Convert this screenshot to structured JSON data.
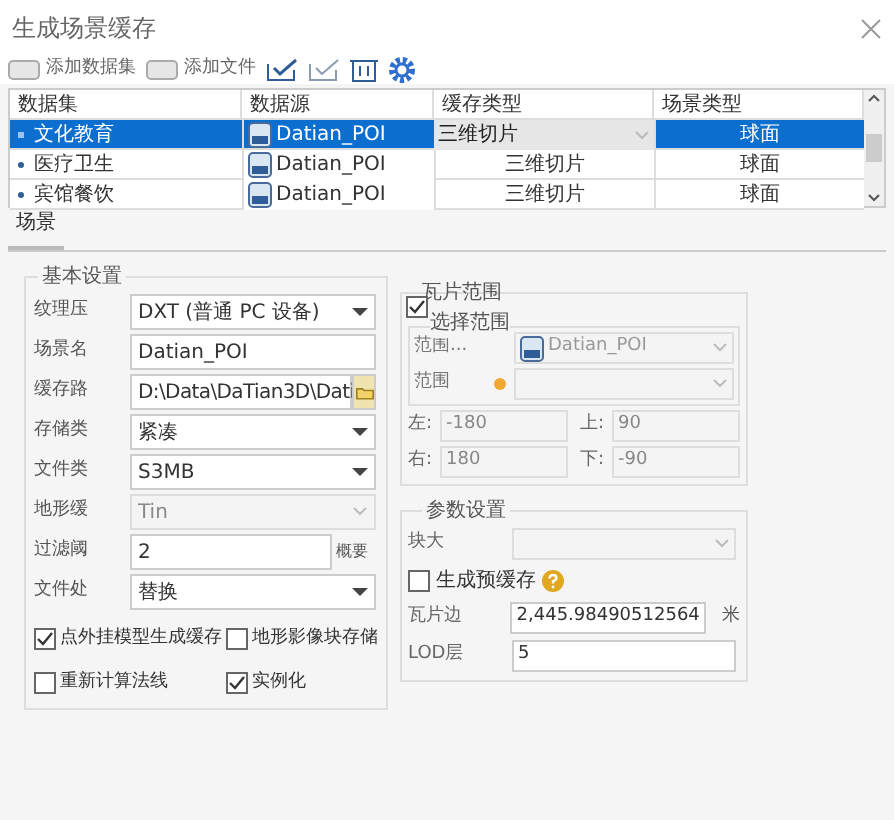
{
  "window": {
    "title": "生成场景缓存"
  },
  "toolbar": [
    {
      "kind": "text",
      "label": "添加数据集"
    },
    {
      "kind": "text",
      "label": "添加文件"
    },
    {
      "kind": "check-all"
    },
    {
      "kind": "check-none"
    },
    {
      "kind": "delete"
    },
    {
      "kind": "settings"
    }
  ],
  "table": {
    "columns": [
      "数据集",
      "数据源",
      "缓存类型",
      "场景类型"
    ],
    "rows": [
      {
        "dataset": "文化教育",
        "source": "Datian_POI",
        "cache_type": "三维切片",
        "scene_type": "球面",
        "selected": true
      },
      {
        "dataset": "医疗卫生",
        "source": "Datian_POI",
        "cache_type": "三维切片",
        "scene_type": "球面",
        "selected": false
      },
      {
        "dataset": "宾馆餐饮",
        "source": "Datian_POI",
        "cache_type": "三维切片",
        "scene_type": "球面",
        "selected": false
      }
    ]
  },
  "tabs": [
    {
      "label": "场景",
      "selected": true
    }
  ],
  "basic": {
    "title": "基本设置",
    "fields": [
      {
        "label": "纹理压",
        "kind": "select",
        "value": "DXT (普通 PC 设备)",
        "disabled": false
      },
      {
        "label": "场景名",
        "kind": "text",
        "value": "Datian_POI",
        "disabled": false
      },
      {
        "label": "缓存路",
        "kind": "path",
        "value": "D:\\Data\\DaTian3D\\Dati",
        "disabled": false
      },
      {
        "label": "存储类",
        "kind": "select",
        "value": "紧凑",
        "disabled": false
      },
      {
        "label": "文件类",
        "kind": "select",
        "value": "S3MB",
        "disabled": false
      },
      {
        "label": "地形缓",
        "kind": "select",
        "value": "Tin",
        "disabled": true
      },
      {
        "label": "过滤阈",
        "kind": "text",
        "value": "2",
        "suffix": "概要",
        "disabled": false
      },
      {
        "label": "文件处",
        "kind": "select",
        "value": "替换",
        "disabled": false
      }
    ],
    "checks": [
      {
        "label": "点外挂模型生成缓存",
        "checked": true
      },
      {
        "label": "地形影像块存储",
        "checked": false
      },
      {
        "label": "重新计算法线",
        "checked": false
      },
      {
        "label": "实例化",
        "checked": true
      }
    ]
  },
  "tile_range": {
    "title": "瓦片范围",
    "checked": true,
    "select_title": "选择范围",
    "rows": [
      {
        "label": "范围...",
        "value": "Datian_POI"
      },
      {
        "label": "范围"
      }
    ],
    "bounds": [
      {
        "label": "左:",
        "value": "-180"
      },
      {
        "label": "上:",
        "value": "90"
      },
      {
        "label": "右:",
        "value": "180"
      },
      {
        "label": "下:",
        "value": "-90"
      }
    ]
  },
  "params": {
    "title": "参数设置",
    "block_label": "块大",
    "precache": {
      "label": "生成预缓存",
      "checked": false
    },
    "tile_label": "瓦片边",
    "tile_value": "2,445.98490512564",
    "tile_unit": "米",
    "lod_label": "LOD层",
    "lod_value": "5"
  }
}
